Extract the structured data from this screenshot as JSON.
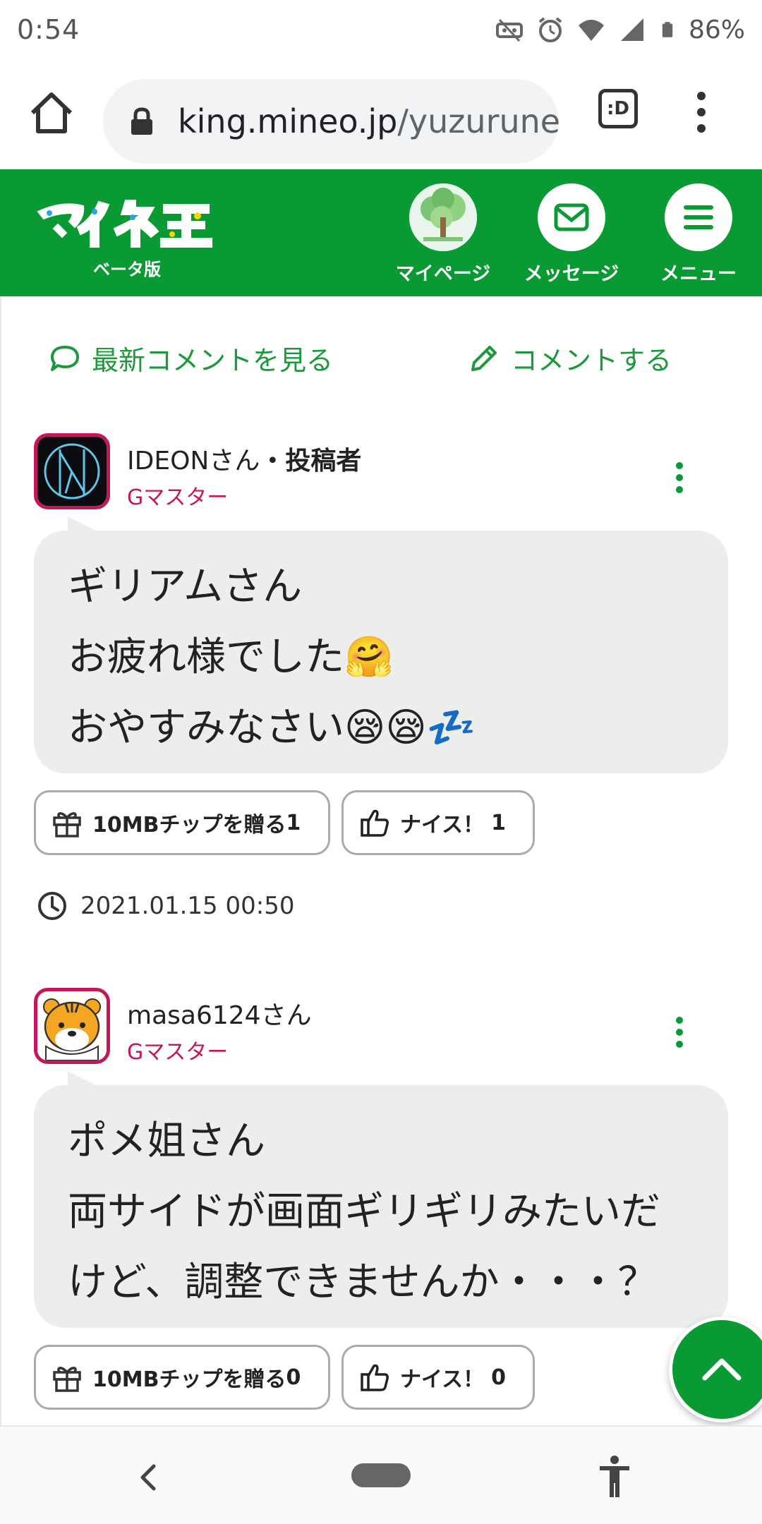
{
  "status_bar": {
    "time": "0:54",
    "battery": "86%"
  },
  "browser": {
    "url_host": "king.mineo.jp",
    "url_path": "/yuzurune/",
    "tab_label": ":D"
  },
  "site": {
    "beta_label": "ベータ版",
    "nav": [
      {
        "label": "マイページ"
      },
      {
        "label": "メッセージ"
      },
      {
        "label": "メニュー"
      }
    ]
  },
  "actions": {
    "latest_comments": "最新コメントを見る",
    "comment": "コメントする"
  },
  "posts": [
    {
      "username": "IDEONさん",
      "poster_suffix": "・投稿者",
      "rank": "Gマスター",
      "lines": [
        "ギリアムさん",
        "お疲れ様でした🤗",
        "おやすみなさい😪😪💤"
      ],
      "gift_label": "10MBチップを贈る",
      "gift_count": "1",
      "nice_label": "ナイス！",
      "nice_count": "1",
      "timestamp": "2021.01.15 00:50"
    },
    {
      "username": "masa6124さん",
      "rank": "Gマスター",
      "lines": [
        "ポメ姐さん",
        "両サイドが画面ギリギリみたいだ",
        "けど、調整できませんか・・・？"
      ],
      "gift_label": "10MBチップを贈る",
      "gift_count": "0",
      "nice_label": "ナイス！",
      "nice_count": "0"
    }
  ],
  "colors": {
    "brand_green": "#0a9a33",
    "rank_pink": "#c2185b",
    "bubble_gray": "#ebeeeb"
  }
}
